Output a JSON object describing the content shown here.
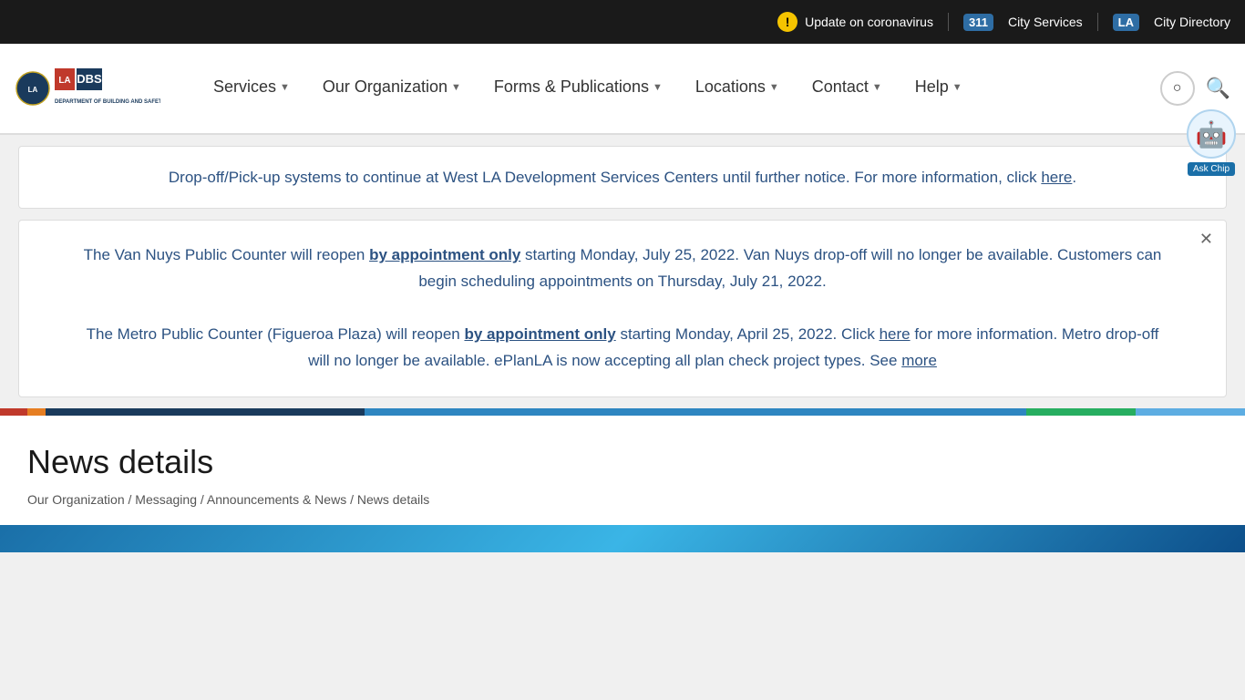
{
  "topbar": {
    "alert_icon": "!",
    "alert_text": "Update on coronavirus",
    "city_services_badge": "311",
    "city_services_label": "City Services",
    "city_directory_badge": "LA",
    "city_directory_label": "City Directory"
  },
  "logo": {
    "city": "LOS ANGELES",
    "dept": "DEPARTMENT OF BUILDING AND SAFETY"
  },
  "nav": {
    "items": [
      {
        "label": "Services",
        "id": "services"
      },
      {
        "label": "Our Organization",
        "id": "our-organization"
      },
      {
        "label": "Forms & Publications",
        "id": "forms-publications"
      },
      {
        "label": "Locations",
        "id": "locations"
      },
      {
        "label": "Contact",
        "id": "contact"
      },
      {
        "label": "Help",
        "id": "help"
      }
    ]
  },
  "banner1": {
    "text_before": "Drop-off/Pick-up systems to continue at West LA Development Services Centers until further notice. For more information, click",
    "link_text": "here",
    "text_after": "."
  },
  "banner2": {
    "para1_before": "The Van Nuys Public Counter will reopen",
    "para1_link": "by appointment only",
    "para1_after": "starting Monday, July 25, 2022. Van Nuys drop-off will no longer be available. Customers can begin scheduling appointments on Thursday, July 21, 2022.",
    "para2_before": "The Metro Public Counter (Figueroa Plaza) will reopen",
    "para2_link": "by appointment only",
    "para2_middle": "starting Monday, April 25, 2022. Click",
    "para2_link2": "here",
    "para2_after": "for more information. Metro drop-off will no longer be available. ePlanLA is now accepting all plan check project types. See",
    "para2_link3": "more"
  },
  "news": {
    "title": "News details",
    "breadcrumb": {
      "items": [
        {
          "label": "Our Organization",
          "url": "#"
        },
        {
          "label": "Messaging",
          "url": "#"
        },
        {
          "label": "Announcements & News",
          "url": "#"
        },
        {
          "label": "News details",
          "url": "#"
        }
      ]
    }
  },
  "askchip": {
    "label": "Ask Chip"
  }
}
